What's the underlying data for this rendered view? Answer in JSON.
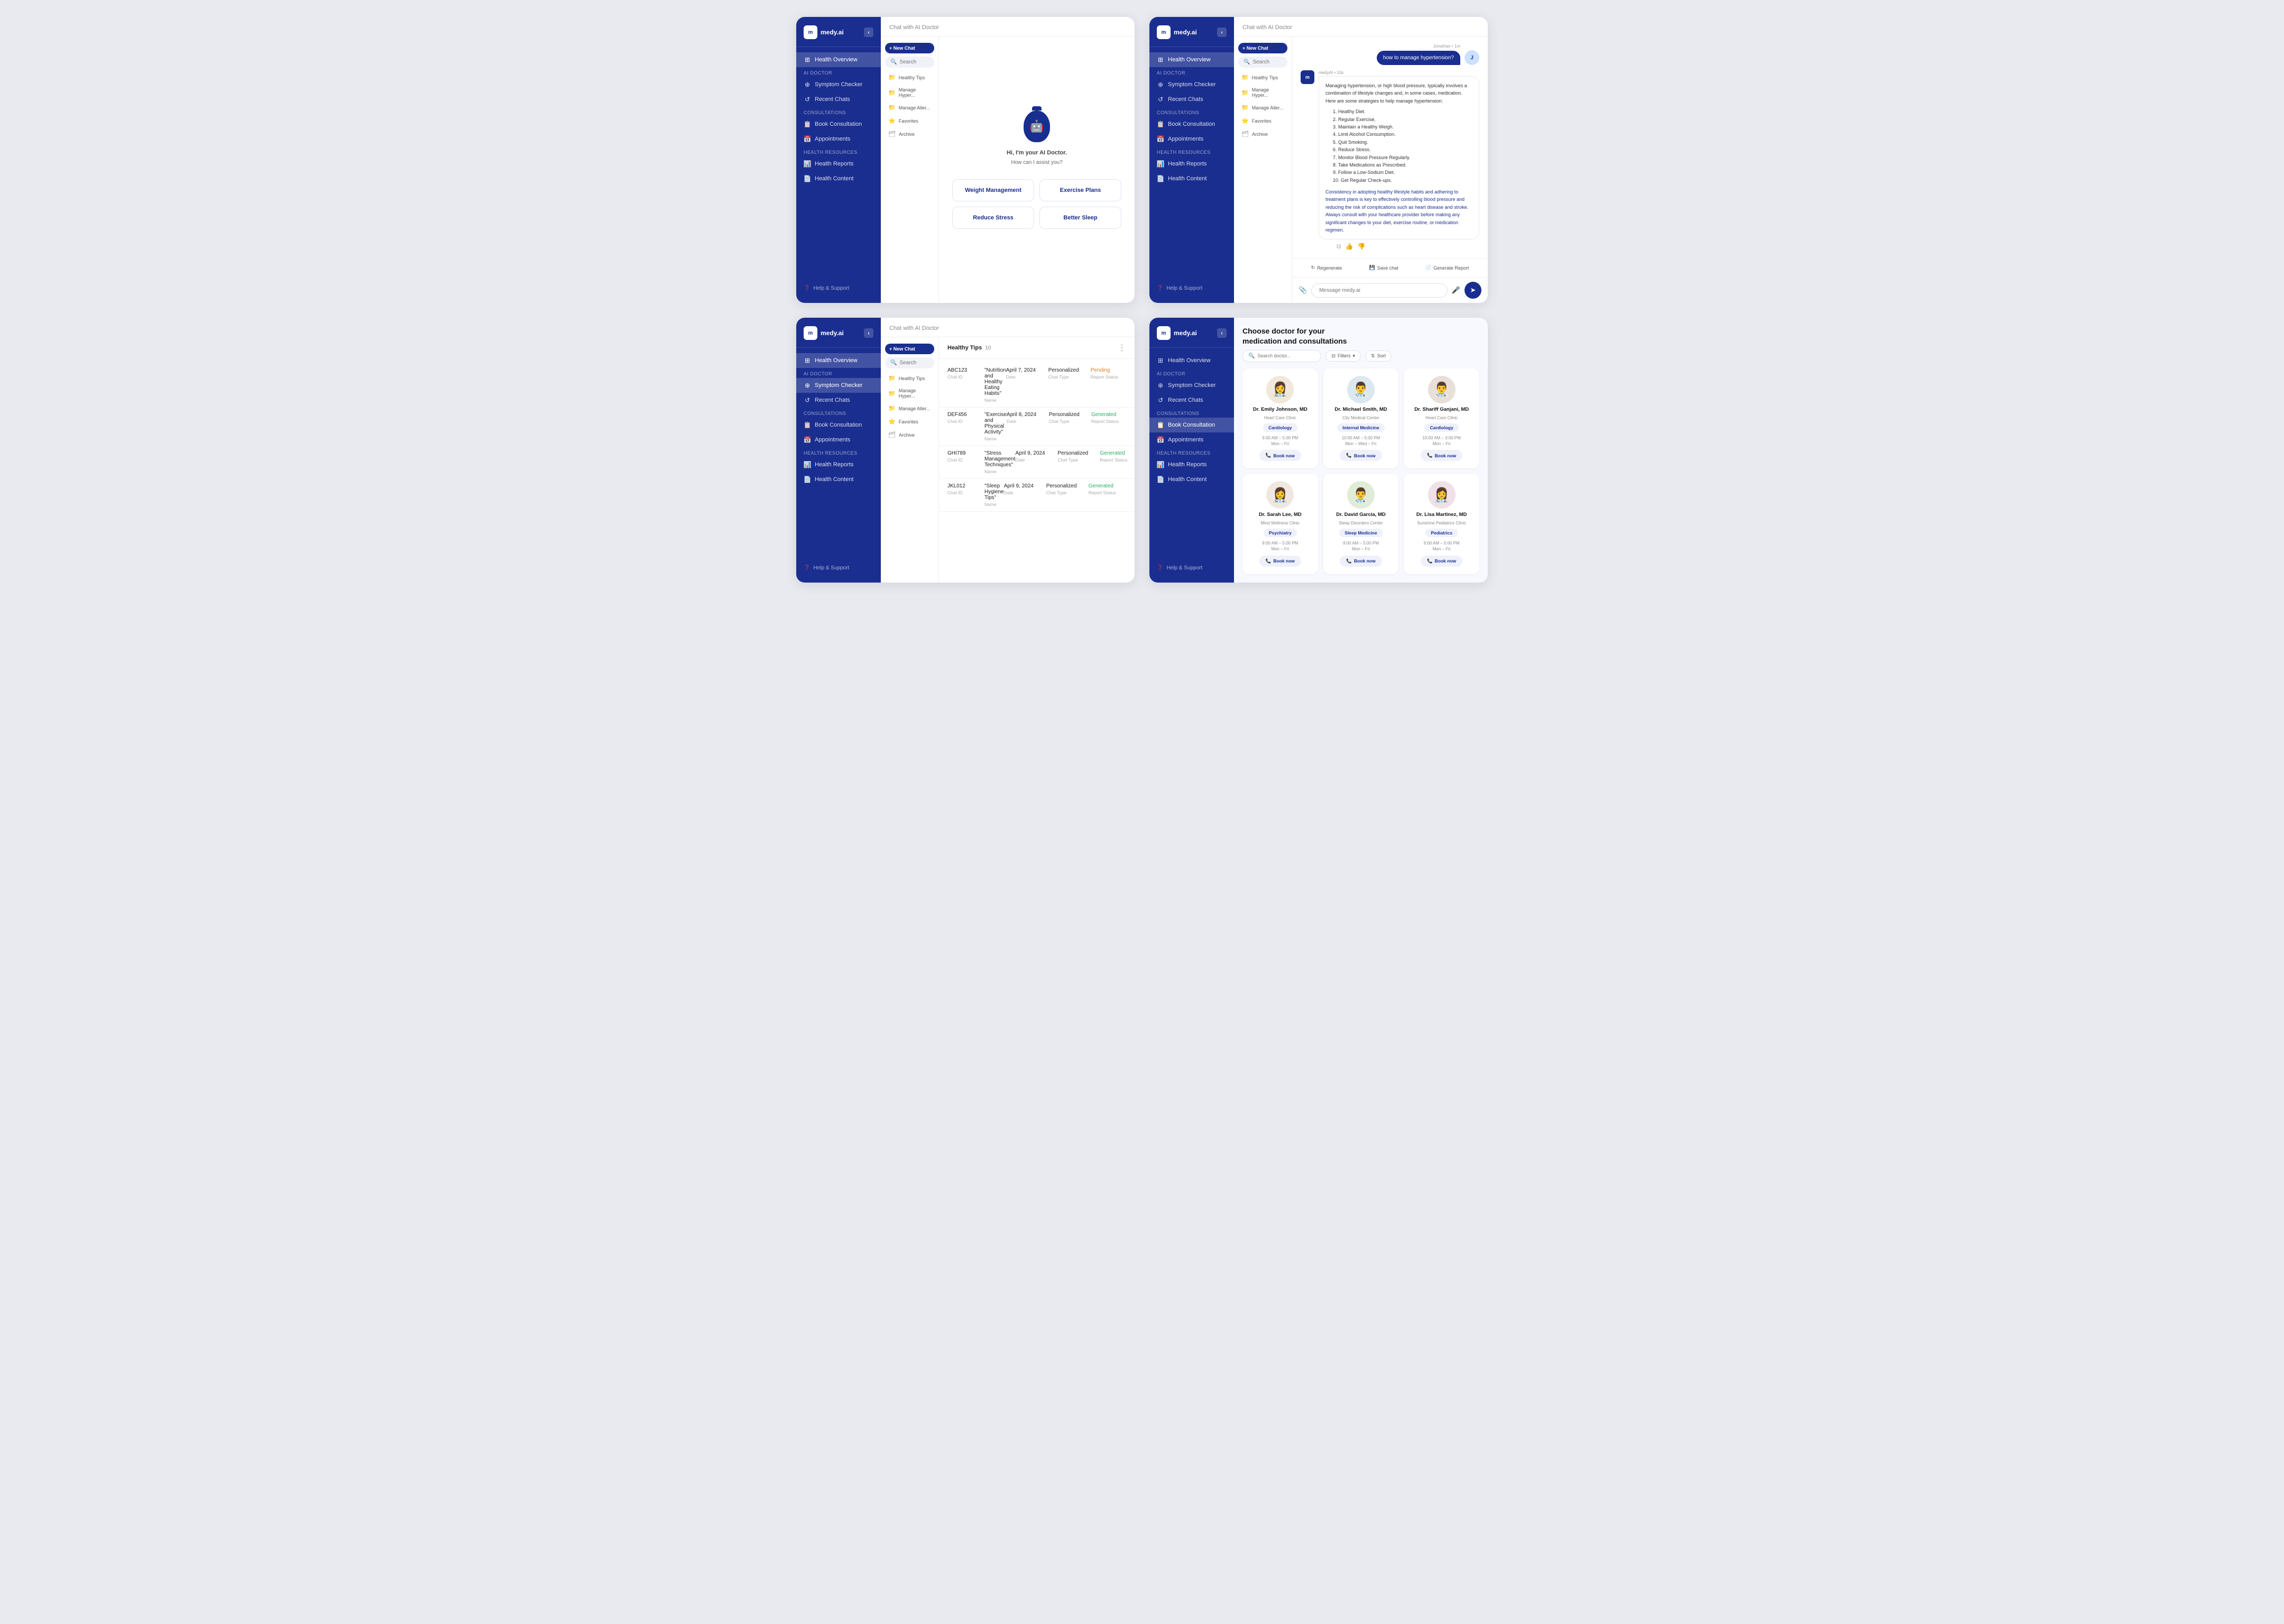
{
  "app": {
    "name": "medy.ai",
    "logo_letter": "m"
  },
  "sidebar": {
    "collapse_icon": "‹",
    "health_overview_label": "Health Overview",
    "ai_doctor_section": "AI Doctor",
    "symptom_checker_label": "Symptom Checker",
    "recent_chats_label": "Recent Chats",
    "consultations_section": "Consultations",
    "book_consultation_label": "Book Consultation",
    "appointments_label": "Appointments",
    "health_resources_section": "Health Resources",
    "health_reports_label": "Health Reports",
    "health_content_label": "Health Content",
    "help_support_label": "Help & Support"
  },
  "secondary_sidebar": {
    "healthy_tips": "Healthy Tips",
    "manage_hyper": "Manage Hyper...",
    "manage_aller": "Manage Aller...",
    "favorites": "Favorites",
    "archive": "Archive"
  },
  "panel1": {
    "header": "Chat with AI Doctor",
    "new_chat_label": "+ New Chat",
    "search_placeholder": "Search",
    "welcome_text": "Hi, I'm your AI Doctor.\nHow can I assist you?",
    "suggestions": [
      "Weight Management",
      "Exercise Plans",
      "Reduce Stress",
      "Better Sleep"
    ]
  },
  "panel2": {
    "header": "Chat with AI Doctor",
    "new_chat_label": "+ New Chat",
    "search_placeholder": "Search",
    "user_name": "Jonathan",
    "user_time": "1m",
    "user_message": "how to manage hypertension?",
    "ai_name": "medyAI",
    "ai_time": "10s",
    "ai_intro": "Managing hypertension, or high blood pressure, typically involves a combination of lifestyle changes and, in some cases, medication. Here are some strategies to help manage hypertension:",
    "ai_list": [
      "1. Healthy Diet.",
      "2. Regular Exercise.",
      "3. Maintain a Healthy Weigh.",
      "4. Limit Alcohol Consumption.",
      "5. Quit Smoking.",
      "6. Reduce Stress.",
      "7. Monitor Blood Pressure Regularly.",
      "8. Take Medications as Prescribed.",
      "9. Follow a Low-Sodium Diet.",
      "10. Get Regular Check-ups."
    ],
    "ai_conclusion": "Consistency in adopting healthy lifestyle habits and adhering to treatment plans is key to effectively controlling blood pressure and reducing the risk of complications such as heart disease and stroke. Always consult with your healthcare provider before making any significant changes to your diet, exercise routine, or medication regimen.",
    "regenerate_label": "Regenerate",
    "save_chat_label": "Save chat",
    "generate_report_label": "Generate Report",
    "message_placeholder": "Message medy.ai"
  },
  "panel3": {
    "header": "Chat with AI Doctor",
    "tab_label": "Healthy Tips",
    "count": "10",
    "new_chat_label": "+ New Chat",
    "search_placeholder": "Search",
    "columns": [
      "Chat ID",
      "Name",
      "Date",
      "Chat Type",
      "Report Status"
    ],
    "rows": [
      {
        "id": "ABC123",
        "id_label": "Chat ID",
        "name": "\"Nutrition and Healthy Eating Habits\"",
        "name_label": "Name",
        "date": "April 7, 2024",
        "date_label": "Date",
        "type": "Personalized",
        "type_label": "Chat Type",
        "status": "Pending",
        "status_label": "Report Status"
      },
      {
        "id": "DEF456",
        "id_label": "Chat ID",
        "name": "\"Exercise and Physical Activity\"",
        "name_label": "Name",
        "date": "April 8, 2024",
        "date_label": "Date",
        "type": "Personalized",
        "type_label": "Chat Type",
        "status": "Generated",
        "status_label": "Report Status"
      },
      {
        "id": "GHI789",
        "id_label": "Chat ID",
        "name": "\"Stress Management Techniques\"",
        "name_label": "Name",
        "date": "April 9, 2024",
        "date_label": "Date",
        "type": "Personalized",
        "type_label": "Chat Type",
        "status": "Generated",
        "status_label": "Report Status"
      },
      {
        "id": "JKL012",
        "id_label": "Chat ID",
        "name": "\"Sleep Hygiene Tips\"",
        "name_label": "Name",
        "date": "April 9, 2024",
        "date_label": "Date",
        "type": "Personalized",
        "type_label": "Chat Type",
        "status": "Generated",
        "status_label": "Report Status"
      }
    ]
  },
  "panel4": {
    "title": "Choose doctor for your medication and consultations",
    "search_placeholder": "Search doctor...",
    "filters_label": "Filters",
    "sort_label": "Sort",
    "doctors": [
      {
        "name": "Dr. Emily Johnson, MD",
        "clinic": "Heart Care Clinic",
        "specialty": "Cardiology",
        "hours": "9:00 AM – 5:00 PM",
        "days": "Mon – Fri",
        "avatar_color": "#f0e8d8",
        "avatar_emoji": "👩‍⚕️"
      },
      {
        "name": "Dr. Michael Smith, MD",
        "clinic": "City Medical Center",
        "specialty": "Internal Medicine",
        "hours": "10:00 AM – 5:00 PM",
        "days": "Mon – Wed – Fri",
        "avatar_color": "#dce8f0",
        "avatar_emoji": "👨‍⚕️"
      },
      {
        "name": "Dr. Shariff Ganjani, MD",
        "clinic": "Heart Care Clinic",
        "specialty": "Cardiology",
        "hours": "10:00 AM – 3:00 PM",
        "days": "Mon – Fri",
        "avatar_color": "#e8e0d8",
        "avatar_emoji": "👨‍⚕️"
      },
      {
        "name": "Dr. Sarah Lee, MD",
        "clinic": "Mind Wellness Clinic",
        "specialty": "Psychiatry",
        "hours": "9:00 AM – 5:00 PM",
        "days": "Mon – Fri",
        "avatar_color": "#f0e8e0",
        "avatar_emoji": "👩‍⚕️"
      },
      {
        "name": "Dr. David Garcia, MD",
        "clinic": "Sleep Disorders Center",
        "specialty": "Sleep Medicine",
        "hours": "9:00 AM – 5:00 PM",
        "days": "Mon – Fri",
        "avatar_color": "#e0ecd8",
        "avatar_emoji": "👨‍⚕️"
      },
      {
        "name": "Dr. Lisa Martinez, MD",
        "clinic": "Sunshine Pediatrics Clinic",
        "specialty": "Pediatrics",
        "hours": "9:00 AM – 5:00 PM",
        "days": "Mon – Fri",
        "avatar_color": "#f0e0e8",
        "avatar_emoji": "👩‍⚕️"
      }
    ],
    "book_now_label": "Book now"
  }
}
